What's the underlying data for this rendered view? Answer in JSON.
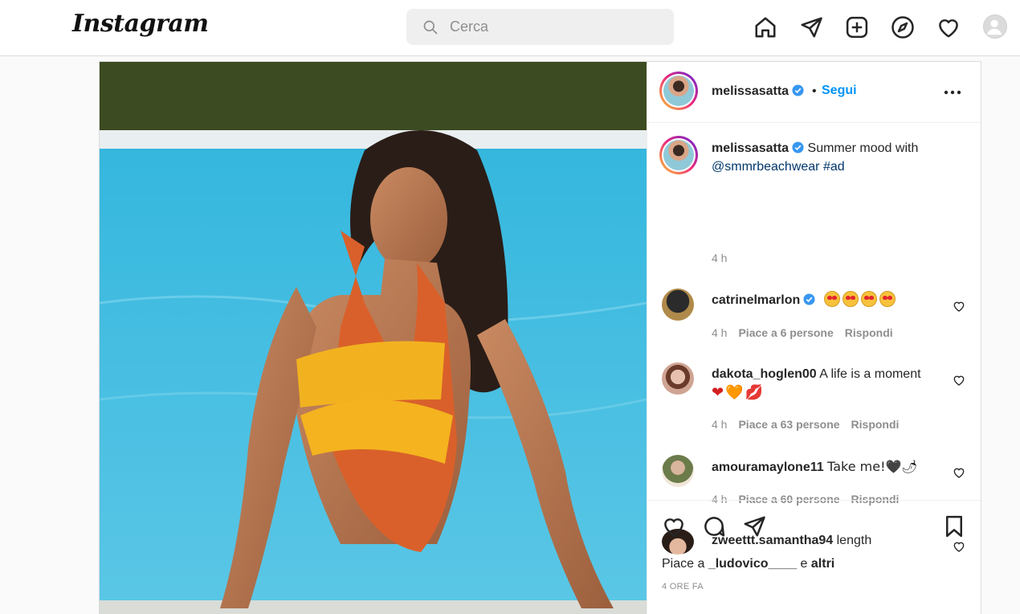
{
  "app": {
    "logo": "Instagram"
  },
  "search": {
    "placeholder": "Cerca"
  },
  "nav": [
    "home-icon",
    "direct-icon",
    "new-post-icon",
    "explore-icon",
    "activity-icon",
    "profile-avatar"
  ],
  "post": {
    "author": "melissasatta",
    "verified": true,
    "separator": "•",
    "follow_label": "Segui",
    "caption": {
      "user": "melissasatta",
      "text": "Summer mood with",
      "mention": "@smmrbeachwear",
      "hashtag": "#ad",
      "time": "4 h"
    },
    "comments": [
      {
        "user": "catrinelmarlon",
        "verified": true,
        "text": "",
        "emojis": "heart-eyes x4",
        "time": "4 h",
        "likes": "Piace a 6 persone",
        "reply": "Rispondi"
      },
      {
        "user": "dakota_hoglen00",
        "verified": false,
        "text": "A life is a moment",
        "emojis": "❤🧡💋",
        "time": "4 h",
        "likes": "Piace a 63 persone",
        "reply": "Rispondi"
      },
      {
        "user": "amouramaylone11",
        "verified": false,
        "text": "Take me!🖤🌶",
        "time": "4 h",
        "likes": "Piace a 60 persone",
        "reply": "Rispondi"
      },
      {
        "user": "zweettt.samantha94",
        "verified": false,
        "text": "length"
      }
    ],
    "likes_prefix": "Piace a ",
    "likes_user": "_ludovico____",
    "likes_mid": " e ",
    "likes_suffix": "altri",
    "time_ago": "4 ORE FA"
  },
  "colors": {
    "accent": "#0095f6",
    "link": "#00376b",
    "muted": "#8e8e8e"
  }
}
